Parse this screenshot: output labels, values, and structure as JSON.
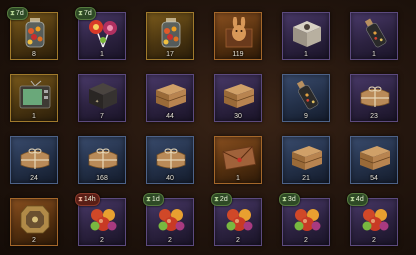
{
  "inventory": {
    "items": [
      {
        "name": "Candy Jar",
        "count": "8",
        "rarity": "gold",
        "timer": "7d",
        "icon": "candy-jar-icon"
      },
      {
        "name": "Lollipops",
        "count": "1",
        "rarity": "purple",
        "timer": "7d",
        "icon": "lollipop-icon"
      },
      {
        "name": "Candy Jar",
        "count": "17",
        "rarity": "gold",
        "timer": "",
        "icon": "candy-jar-icon"
      },
      {
        "name": "Bunny Box",
        "count": "119",
        "rarity": "orange",
        "timer": "",
        "icon": "bunny-box-icon"
      },
      {
        "name": "Gift Box",
        "count": "1",
        "rarity": "purple",
        "timer": "",
        "icon": "open-box-icon"
      },
      {
        "name": "Bottle",
        "count": "1",
        "rarity": "purple",
        "timer": "",
        "icon": "bottle-icon"
      },
      {
        "name": "Television",
        "count": "1",
        "rarity": "gold",
        "timer": "",
        "icon": "tv-icon"
      },
      {
        "name": "Dark Crate",
        "count": "7",
        "rarity": "purple",
        "timer": "",
        "icon": "dark-crate-icon"
      },
      {
        "name": "Wooden Crate",
        "count": "44",
        "rarity": "purple",
        "timer": "",
        "icon": "wooden-crate-icon"
      },
      {
        "name": "Wooden Crate",
        "count": "30",
        "rarity": "purple",
        "timer": "",
        "icon": "wooden-crate-icon"
      },
      {
        "name": "Bottle",
        "count": "9",
        "rarity": "blue",
        "timer": "",
        "icon": "bottle-icon"
      },
      {
        "name": "Parcel",
        "count": "23",
        "rarity": "purple",
        "timer": "",
        "icon": "parcel-icon"
      },
      {
        "name": "Parcel",
        "count": "24",
        "rarity": "blue",
        "timer": "",
        "icon": "parcel-icon"
      },
      {
        "name": "Parcel",
        "count": "168",
        "rarity": "blue",
        "timer": "",
        "icon": "parcel-icon"
      },
      {
        "name": "Parcel",
        "count": "40",
        "rarity": "blue",
        "timer": "",
        "icon": "parcel-icon"
      },
      {
        "name": "Envelope",
        "count": "1",
        "rarity": "orange",
        "timer": "",
        "icon": "envelope-icon"
      },
      {
        "name": "Wooden Crate",
        "count": "21",
        "rarity": "blue",
        "timer": "",
        "icon": "wooden-crate-icon"
      },
      {
        "name": "Wooden Crate",
        "count": "54",
        "rarity": "blue",
        "timer": "",
        "icon": "wooden-crate-icon"
      },
      {
        "name": "Ornate Box",
        "count": "2",
        "rarity": "orange",
        "timer": "",
        "icon": "ornate-box-icon"
      },
      {
        "name": "Candies",
        "count": "2",
        "rarity": "purple",
        "timer": "14h",
        "timer_style": "red",
        "icon": "candies-icon"
      },
      {
        "name": "Candies",
        "count": "2",
        "rarity": "purple",
        "timer": "1d",
        "icon": "candies-icon"
      },
      {
        "name": "Candies",
        "count": "2",
        "rarity": "purple",
        "timer": "2d",
        "icon": "candies-icon"
      },
      {
        "name": "Candies",
        "count": "2",
        "rarity": "purple",
        "timer": "3d",
        "icon": "candies-icon"
      },
      {
        "name": "Candies",
        "count": "2",
        "rarity": "purple",
        "timer": "4d",
        "icon": "candies-icon"
      }
    ]
  }
}
